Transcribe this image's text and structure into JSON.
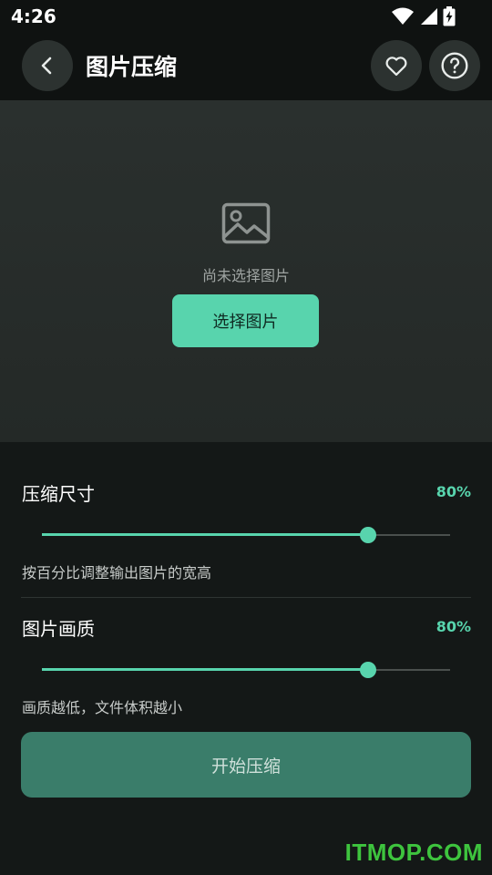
{
  "status_bar": {
    "time": "4:26",
    "icons": [
      "wifi-icon",
      "cell-signal-icon",
      "battery-charging-icon"
    ]
  },
  "app_bar": {
    "title": "图片压缩",
    "back_icon": "chevron-left-icon",
    "actions": [
      "heart-icon",
      "help-circle-icon"
    ]
  },
  "preview": {
    "placeholder_icon": "image-icon",
    "empty_text": "尚未选择图片",
    "select_button": "选择图片"
  },
  "size_setting": {
    "title": "压缩尺寸",
    "value_text": "80%",
    "value": 0.8,
    "description": "按百分比调整输出图片的宽高"
  },
  "quality_setting": {
    "title": "图片画质",
    "value_text": "80%",
    "value": 0.8,
    "description": "画质越低，文件体积越小"
  },
  "start_button": "开始压缩",
  "watermark": "ITMOP.COM",
  "colors": {
    "accent": "#58d4ad",
    "background": "#141817",
    "preview_bg": "#272c2a",
    "start_button": "#3a7d6a"
  }
}
